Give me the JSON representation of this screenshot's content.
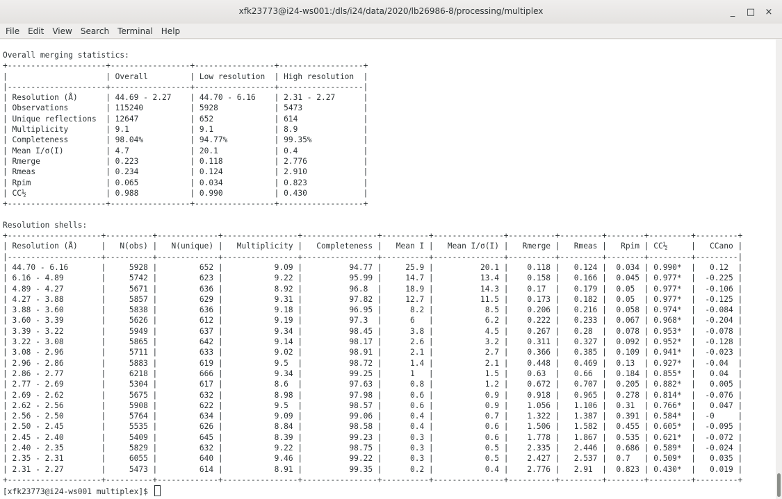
{
  "window": {
    "title": "xfk23773@i24-ws001:/dls/i24/data/2020/lb26986-8/processing/multiplex",
    "buttons": {
      "minimize": "_",
      "maximize": "□",
      "close": "×"
    }
  },
  "menu": [
    "File",
    "Edit",
    "View",
    "Search",
    "Terminal",
    "Help"
  ],
  "terminal": {
    "lines": [
      "Overall merging statistics:",
      "+---------------------+-----------------+-----------------+------------------+",
      "|                     | Overall         | Low resolution  | High resolution  |",
      "|---------------------+-----------------+-----------------+------------------|",
      "| Resolution (Å)      | 44.69 - 2.27    | 44.70 - 6.16    | 2.31 - 2.27      |",
      "| Observations        | 115240          | 5928            | 5473             |",
      "| Unique reflections  | 12647           | 652             | 614              |",
      "| Multiplicity        | 9.1             | 9.1             | 8.9              |",
      "| Completeness        | 98.04%          | 94.77%          | 99.35%           |",
      "| Mean I/σ(I)         | 4.7             | 20.1            | 0.4              |",
      "| Rmerge              | 0.223           | 0.118           | 2.776            |",
      "| Rmeas               | 0.234           | 0.124           | 2.910            |",
      "| Rpim                | 0.065           | 0.034           | 0.823            |",
      "| CC½                 | 0.988           | 0.990           | 0.430            |",
      "+---------------------+-----------------+-----------------+------------------+",
      "",
      "Resolution shells:",
      "+--------------------+----------+-------------+----------------+----------------+----------+---------------+----------+---------+--------+---------+---------+",
      "| Resolution (Å)     |   N(obs) |   N(unique) |   Multiplicity |   Completeness |   Mean I |   Mean I/σ(I) |   Rmerge |   Rmeas |   Rpim | CC½     |   CCano |",
      "|--------------------+----------+-------------+----------------+----------------+----------+---------------+----------+---------+--------+---------+---------|",
      "| 44.70 - 6.16       |     5928 |         652 |           9.09 |          94.77 |     25.9 |          20.1 |    0.118 |   0.124 |  0.034 | 0.990*  |   0.12  |",
      "| 6.16 - 4.89        |     5742 |         623 |           9.22 |          95.99 |     14.7 |          13.4 |    0.158 |   0.166 |  0.045 | 0.977*  |  -0.225 |",
      "| 4.89 - 4.27        |     5671 |         636 |           8.92 |          96.8  |     18.9 |          14.3 |    0.17  |   0.179 |  0.05  | 0.977*  |  -0.106 |",
      "| 4.27 - 3.88        |     5857 |         629 |           9.31 |          97.82 |     12.7 |          11.5 |    0.173 |   0.182 |  0.05  | 0.977*  |  -0.125 |",
      "| 3.88 - 3.60        |     5838 |         636 |           9.18 |          96.95 |      8.2 |           8.5 |    0.206 |   0.216 |  0.058 | 0.974*  |  -0.084 |",
      "| 3.60 - 3.39        |     5626 |         612 |           9.19 |          97.3  |      6   |           6.2 |    0.222 |   0.233 |  0.067 | 0.968*  |  -0.204 |",
      "| 3.39 - 3.22        |     5949 |         637 |           9.34 |          98.45 |      3.8 |           4.5 |    0.267 |   0.28  |  0.078 | 0.953*  |  -0.078 |",
      "| 3.22 - 3.08        |     5865 |         642 |           9.14 |          98.17 |      2.6 |           3.2 |    0.311 |   0.327 |  0.092 | 0.952*  |  -0.128 |",
      "| 3.08 - 2.96        |     5711 |         633 |           9.02 |          98.91 |      2.1 |           2.7 |    0.366 |   0.385 |  0.109 | 0.941*  |  -0.023 |",
      "| 2.96 - 2.86        |     5883 |         619 |           9.5  |          98.72 |      1.4 |           2.1 |    0.448 |   0.469 |  0.13  | 0.927*  |  -0.04  |",
      "| 2.86 - 2.77        |     6218 |         666 |           9.34 |          99.25 |      1   |           1.5 |    0.63  |   0.66  |  0.184 | 0.855*  |   0.04  |",
      "| 2.77 - 2.69        |     5304 |         617 |           8.6  |          97.63 |      0.8 |           1.2 |    0.672 |   0.707 |  0.205 | 0.882*  |   0.005 |",
      "| 2.69 - 2.62        |     5675 |         632 |           8.98 |          97.98 |      0.6 |           0.9 |    0.918 |   0.965 |  0.278 | 0.814*  |  -0.076 |",
      "| 2.62 - 2.56        |     5908 |         622 |           9.5  |          98.57 |      0.6 |           0.9 |    1.056 |   1.106 |  0.31  | 0.766*  |   0.047 |",
      "| 2.56 - 2.50        |     5764 |         634 |           9.09 |          99.06 |      0.4 |           0.7 |    1.322 |   1.387 |  0.391 | 0.584*  |  -0     |",
      "| 2.50 - 2.45        |     5535 |         626 |           8.84 |          98.58 |      0.4 |           0.6 |    1.506 |   1.582 |  0.455 | 0.605*  |  -0.095 |",
      "| 2.45 - 2.40        |     5409 |         645 |           8.39 |          99.23 |      0.3 |           0.6 |    1.778 |   1.867 |  0.535 | 0.621*  |  -0.072 |",
      "| 2.40 - 2.35        |     5829 |         632 |           9.22 |          98.75 |      0.3 |           0.5 |    2.335 |   2.446 |  0.686 | 0.589*  |  -0.024 |",
      "| 2.35 - 2.31        |     6055 |         640 |           9.46 |          99.22 |      0.3 |           0.5 |    2.427 |   2.537 |  0.7   | 0.509*  |   0.035 |",
      "| 2.31 - 2.27        |     5473 |         614 |           8.91 |          99.35 |      0.2 |           0.4 |    2.776 |   2.91  |  0.823 | 0.430*  |   0.019 |",
      "+--------------------+----------+-------------+----------------+----------------+----------+---------------+----------+---------+--------+---------+---------+"
    ],
    "prompt": "[xfk23773@i24-ws001 multiplex]$ "
  }
}
